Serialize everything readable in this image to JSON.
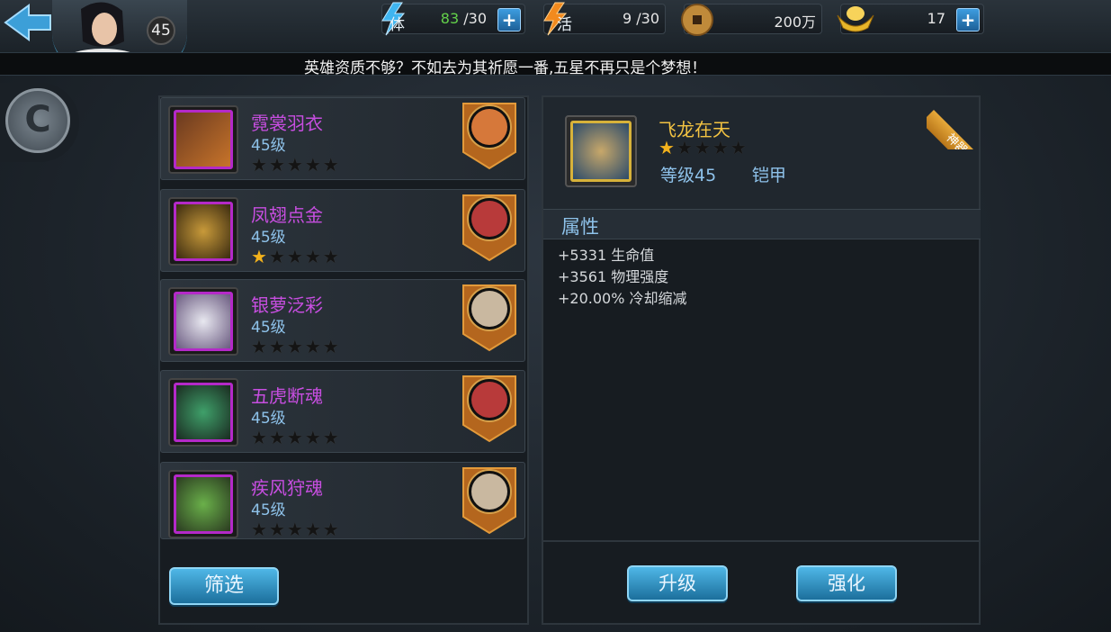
{
  "header": {
    "player_level": "45",
    "stamina": {
      "current": "83",
      "max": "/30"
    },
    "vitality": {
      "value": "9 /30"
    },
    "coins": {
      "value": "200万"
    },
    "gold": {
      "value": "17"
    },
    "stamina_label": "体",
    "vitality_label": "活",
    "plus": "+"
  },
  "ticker": "英雄资质不够？不如去为其祈愿一番,五星不再只是个梦想！",
  "side_button": "C",
  "items": [
    {
      "name": "霓裳羽衣",
      "level": "45级",
      "stars": 0
    },
    {
      "name": "凤翅点金",
      "level": "45级",
      "stars": 1
    },
    {
      "name": "银萝泛彩",
      "level": "45级",
      "stars": 0
    },
    {
      "name": "五虎断魂",
      "level": "45级",
      "stars": 0
    },
    {
      "name": "疾风狩魂",
      "level": "45级",
      "stars": 0
    }
  ],
  "filter_button": "筛选",
  "detail": {
    "name": "飞龙在天",
    "stars": 1,
    "level": "等级45",
    "type": "铠甲",
    "ribbon": "神器",
    "attr_title": "属性",
    "attributes": [
      "+5331 生命值",
      "+3561 物理强度",
      "+20.00% 冷却缩减"
    ]
  },
  "buttons": {
    "upgrade": "升级",
    "enhance": "强化"
  },
  "colors": {
    "item_name": "#c74ee0",
    "detail_name": "#f3c342",
    "level_text": "#8ec2ea",
    "button": "#2a8cc4"
  }
}
